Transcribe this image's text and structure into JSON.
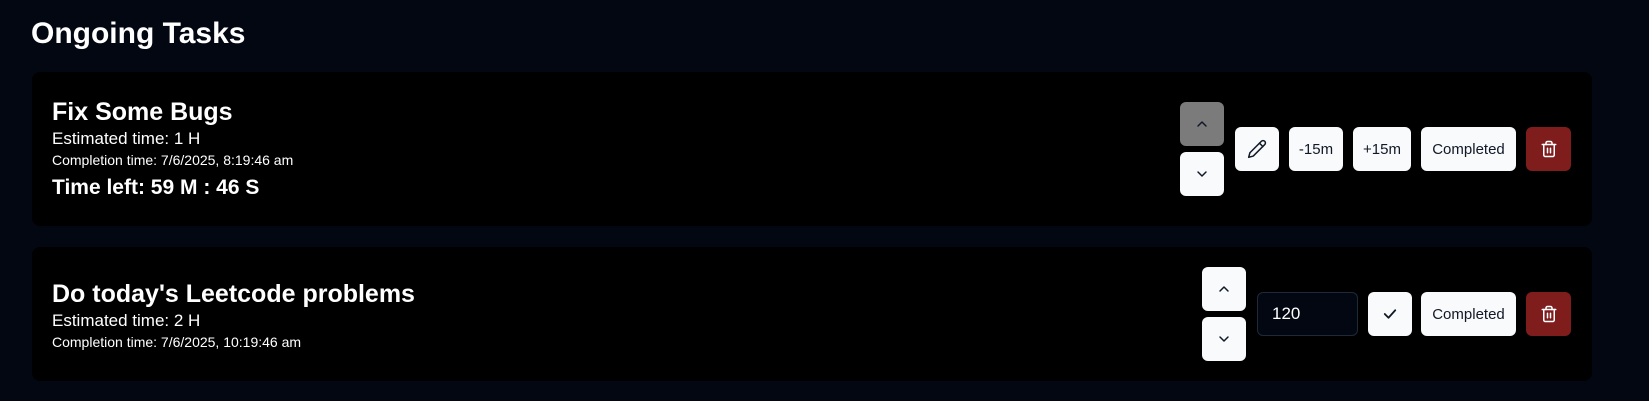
{
  "page": {
    "heading": "Ongoing Tasks"
  },
  "tasks": [
    {
      "title": "Fix Some Bugs",
      "estimated": "Estimated time: 1 H",
      "completion": "Completion time: 7/6/2025, 8:19:46 am",
      "time_left": "Time left: 59 M : 46 S",
      "move_up_disabled": true,
      "edit_icon": "pencil-icon",
      "minus_label": "-15m",
      "plus_label": "+15m",
      "completed_label": "Completed",
      "delete_icon": "trash-icon"
    },
    {
      "title": "Do today's Leetcode problems",
      "estimated": "Estimated time: 2 H",
      "completion": "Completion time: 7/6/2025, 10:19:46 am",
      "edit_value": "120",
      "confirm_icon": "check-icon",
      "completed_label": "Completed",
      "delete_icon": "trash-icon"
    }
  ],
  "colors": {
    "background": "#030712",
    "card": "#000000",
    "button": "#f9fafb",
    "button_disabled": "#7b7b7b",
    "danger": "#7f1d1d"
  }
}
